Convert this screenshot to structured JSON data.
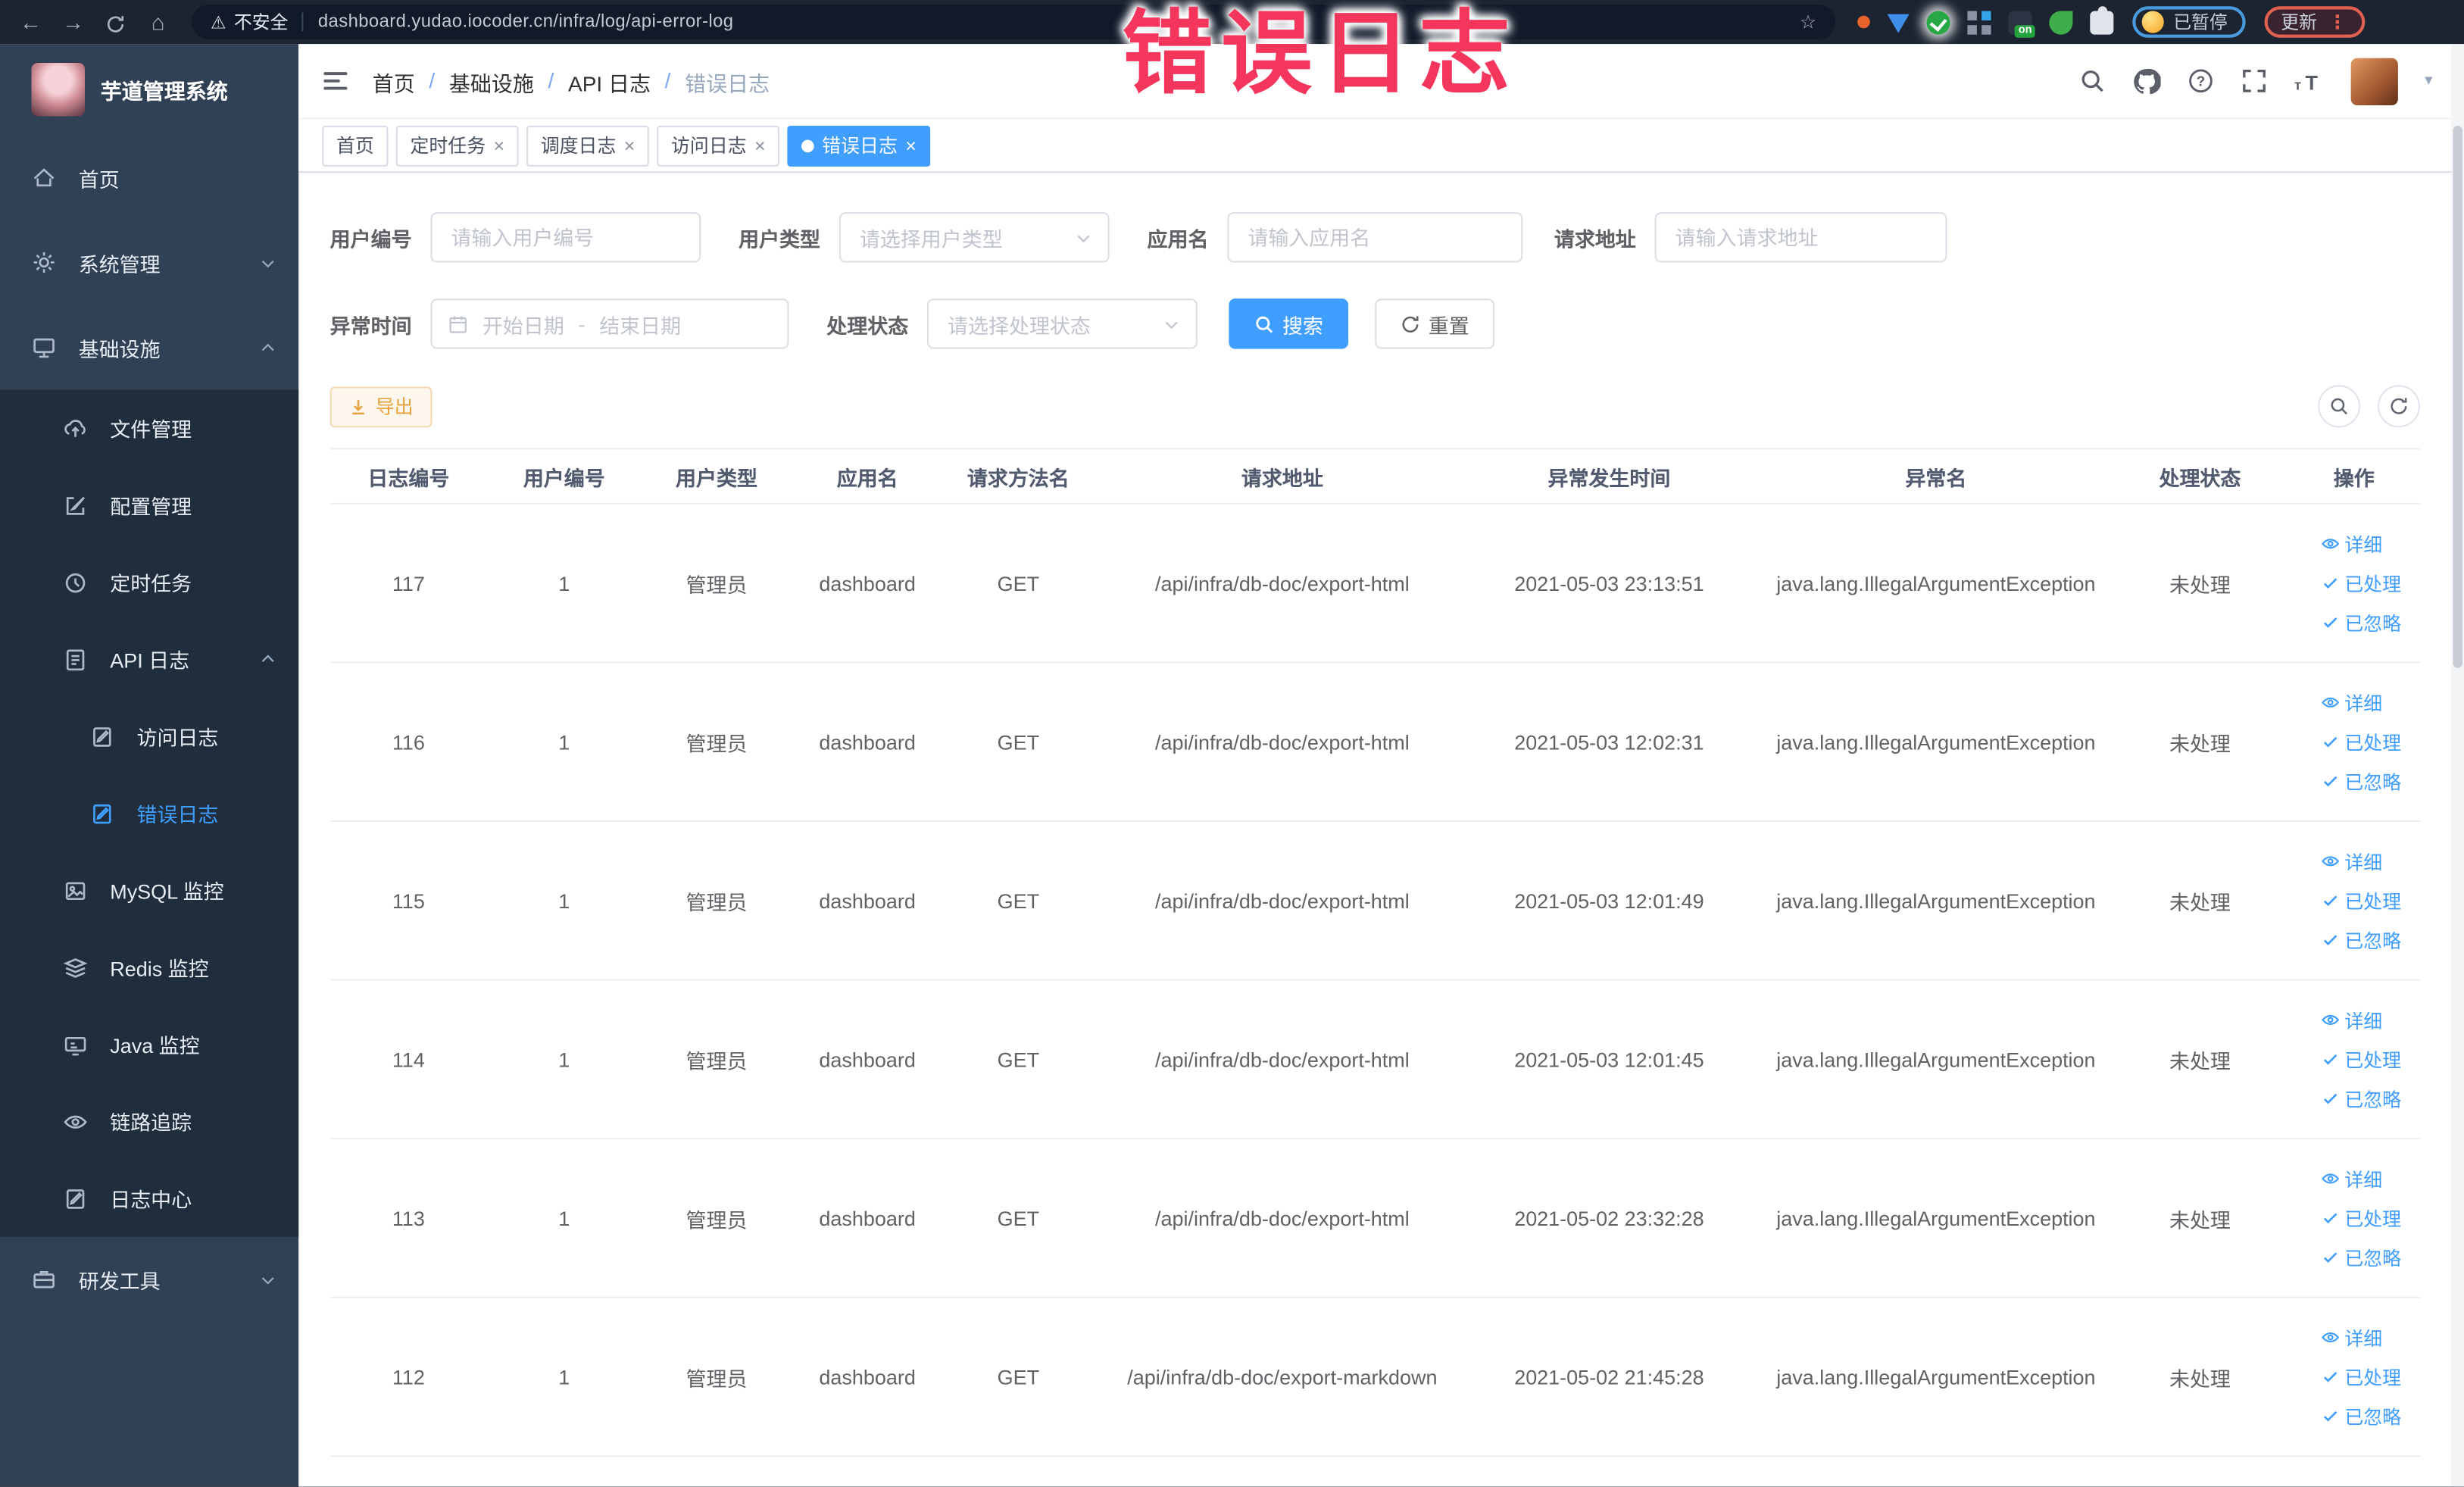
{
  "browser": {
    "security_label": "不安全",
    "url": "dashboard.yudao.iocoder.cn/infra/log/api-error-log",
    "paused_label": "已暂停",
    "update_label": "更新"
  },
  "annotation": {
    "text": "错误日志",
    "color": "#f5365c"
  },
  "sidebar": {
    "logo_title": "芋道管理系统",
    "items": [
      {
        "label": "首页"
      },
      {
        "label": "系统管理"
      },
      {
        "label": "基础设施"
      },
      {
        "label": "文件管理"
      },
      {
        "label": "配置管理"
      },
      {
        "label": "定时任务"
      },
      {
        "label": "API 日志"
      },
      {
        "label": "访问日志"
      },
      {
        "label": "错误日志"
      },
      {
        "label": "MySQL 监控"
      },
      {
        "label": "Redis 监控"
      },
      {
        "label": "Java 监控"
      },
      {
        "label": "链路追踪"
      },
      {
        "label": "日志中心"
      },
      {
        "label": "研发工具"
      }
    ]
  },
  "header": {
    "breadcrumb": {
      "items": [
        "首页",
        "基础设施",
        "API 日志",
        "错误日志"
      ],
      "separator": "/"
    }
  },
  "tabs": [
    {
      "label": "首页"
    },
    {
      "label": "定时任务"
    },
    {
      "label": "调度日志"
    },
    {
      "label": "访问日志"
    },
    {
      "label": "错误日志"
    }
  ],
  "filters": {
    "user_id": {
      "label": "用户编号",
      "placeholder": "请输入用户编号"
    },
    "user_type": {
      "label": "用户类型",
      "placeholder": "请选择用户类型"
    },
    "app_name": {
      "label": "应用名",
      "placeholder": "请输入应用名"
    },
    "request_url": {
      "label": "请求地址",
      "placeholder": "请输入请求地址"
    },
    "exception_time": {
      "label": "异常时间",
      "start_placeholder": "开始日期",
      "separator": "-",
      "end_placeholder": "结束日期"
    },
    "process_status": {
      "label": "处理状态",
      "placeholder": "请选择处理状态"
    },
    "search_label": "搜索",
    "reset_label": "重置"
  },
  "toolbar": {
    "export_label": "导出"
  },
  "table": {
    "columns": [
      "日志编号",
      "用户编号",
      "用户类型",
      "应用名",
      "请求方法名",
      "请求地址",
      "异常发生时间",
      "异常名",
      "处理状态",
      "操作"
    ],
    "action_labels": {
      "detail": "详细",
      "processed": "已处理",
      "ignored": "已忽略"
    },
    "rows": [
      {
        "id": "117",
        "user_id": "1",
        "user_type": "管理员",
        "app": "dashboard",
        "method": "GET",
        "url": "/api/infra/db-doc/export-html",
        "time": "2021-05-03 23:13:51",
        "exception": "java.lang.IllegalArgumentException",
        "status": "未处理"
      },
      {
        "id": "116",
        "user_id": "1",
        "user_type": "管理员",
        "app": "dashboard",
        "method": "GET",
        "url": "/api/infra/db-doc/export-html",
        "time": "2021-05-03 12:02:31",
        "exception": "java.lang.IllegalArgumentException",
        "status": "未处理"
      },
      {
        "id": "115",
        "user_id": "1",
        "user_type": "管理员",
        "app": "dashboard",
        "method": "GET",
        "url": "/api/infra/db-doc/export-html",
        "time": "2021-05-03 12:01:49",
        "exception": "java.lang.IllegalArgumentException",
        "status": "未处理"
      },
      {
        "id": "114",
        "user_id": "1",
        "user_type": "管理员",
        "app": "dashboard",
        "method": "GET",
        "url": "/api/infra/db-doc/export-html",
        "time": "2021-05-03 12:01:45",
        "exception": "java.lang.IllegalArgumentException",
        "status": "未处理"
      },
      {
        "id": "113",
        "user_id": "1",
        "user_type": "管理员",
        "app": "dashboard",
        "method": "GET",
        "url": "/api/infra/db-doc/export-html",
        "time": "2021-05-02 23:32:28",
        "exception": "java.lang.IllegalArgumentException",
        "status": "未处理"
      },
      {
        "id": "112",
        "user_id": "1",
        "user_type": "管理员",
        "app": "dashboard",
        "method": "GET",
        "url": "/api/infra/db-doc/export-markdown",
        "time": "2021-05-02 21:45:28",
        "exception": "java.lang.IllegalArgumentException",
        "status": "未处理"
      }
    ]
  },
  "icons": {
    "back": "←",
    "forward": "→",
    "home": "⌂",
    "warning": "⚠",
    "star": "☆",
    "kebab": "⋮",
    "close": "×",
    "caret_down": "▾",
    "on_badge": "on"
  },
  "colors": {
    "accent": "#409eff",
    "warning": "#e6a23c",
    "annotation": "#f5365c",
    "sidebar_bg": "#304156",
    "submenu_bg": "#1f2d3d"
  }
}
